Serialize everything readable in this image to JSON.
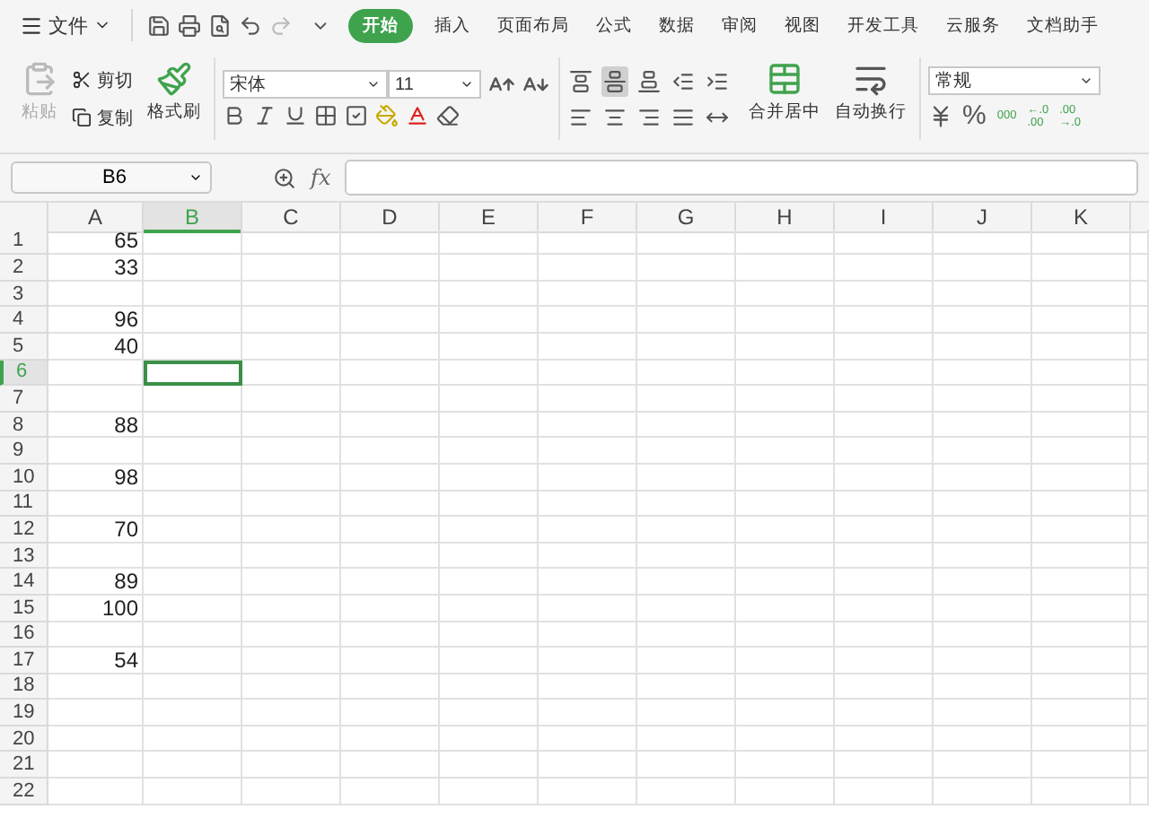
{
  "menu": {
    "label": "文件"
  },
  "tabs": [
    {
      "label": "开始",
      "selected": true
    },
    {
      "label": "插入",
      "selected": false
    },
    {
      "label": "页面布局",
      "selected": false
    },
    {
      "label": "公式",
      "selected": false
    },
    {
      "label": "数据",
      "selected": false
    },
    {
      "label": "审阅",
      "selected": false
    },
    {
      "label": "视图",
      "selected": false
    },
    {
      "label": "开发工具",
      "selected": false
    },
    {
      "label": "云服务",
      "selected": false
    },
    {
      "label": "文档助手",
      "selected": false
    }
  ],
  "clipboard": {
    "paste": {
      "label": "粘贴",
      "disabled": true
    },
    "cut": "剪切",
    "copy": "复制",
    "format_painter": "格式刷"
  },
  "font": {
    "name": "宋体",
    "size": "11"
  },
  "alignment": {
    "buttons": [
      {
        "kind": "top",
        "selected": false
      },
      {
        "kind": "middle",
        "selected": true
      },
      {
        "kind": "bottom",
        "selected": false
      },
      {
        "kind": "outdent",
        "selected": false
      },
      {
        "kind": "indent",
        "selected": false
      },
      {
        "kind": "left",
        "selected": false
      },
      {
        "kind": "center",
        "selected": false
      },
      {
        "kind": "right",
        "selected": false
      },
      {
        "kind": "justify",
        "selected": false
      },
      {
        "kind": "distributed",
        "selected": false
      }
    ],
    "merge": "合并居中",
    "wrap": "自动换行"
  },
  "number": {
    "format": "常规",
    "percent": "%",
    "thousands": "000",
    "increase_decimal": [
      "←.0",
      ".00"
    ],
    "decrease_decimal": [
      ".00",
      "→.0"
    ]
  },
  "name_box": "B6",
  "formula_bar": {
    "fx": "fx"
  },
  "sheet": {
    "columns": [
      {
        "label": "A",
        "selected": false
      },
      {
        "label": "B",
        "selected": true
      },
      {
        "label": "C",
        "selected": false
      },
      {
        "label": "D",
        "selected": false
      },
      {
        "label": "E",
        "selected": false
      },
      {
        "label": "F",
        "selected": false
      },
      {
        "label": "G",
        "selected": false
      },
      {
        "label": "H",
        "selected": false
      },
      {
        "label": "I",
        "selected": false
      },
      {
        "label": "J",
        "selected": false
      },
      {
        "label": "K",
        "selected": false
      }
    ],
    "rows": [
      {
        "label": "1",
        "selected": false,
        "value": "65"
      },
      {
        "label": "2",
        "selected": false,
        "value": "33"
      },
      {
        "label": "3",
        "selected": false
      },
      {
        "label": "4",
        "selected": false,
        "value": "96"
      },
      {
        "label": "5",
        "selected": false,
        "value": "40"
      },
      {
        "label": "6",
        "selected": true
      },
      {
        "label": "7",
        "selected": false
      },
      {
        "label": "8",
        "selected": false,
        "value": "88"
      },
      {
        "label": "9",
        "selected": false
      },
      {
        "label": "10",
        "selected": false,
        "value": "98"
      },
      {
        "label": "11",
        "selected": false
      },
      {
        "label": "12",
        "selected": false,
        "value": "70"
      },
      {
        "label": "13",
        "selected": false
      },
      {
        "label": "14",
        "selected": false,
        "value": "89"
      },
      {
        "label": "15",
        "selected": false,
        "value": "100"
      },
      {
        "label": "16",
        "selected": false
      },
      {
        "label": "17",
        "selected": false,
        "value": "54"
      },
      {
        "label": "18",
        "selected": false
      },
      {
        "label": "19",
        "selected": false
      },
      {
        "label": "20",
        "selected": false
      },
      {
        "label": "21",
        "selected": false
      },
      {
        "label": "22",
        "selected": false
      }
    ]
  }
}
